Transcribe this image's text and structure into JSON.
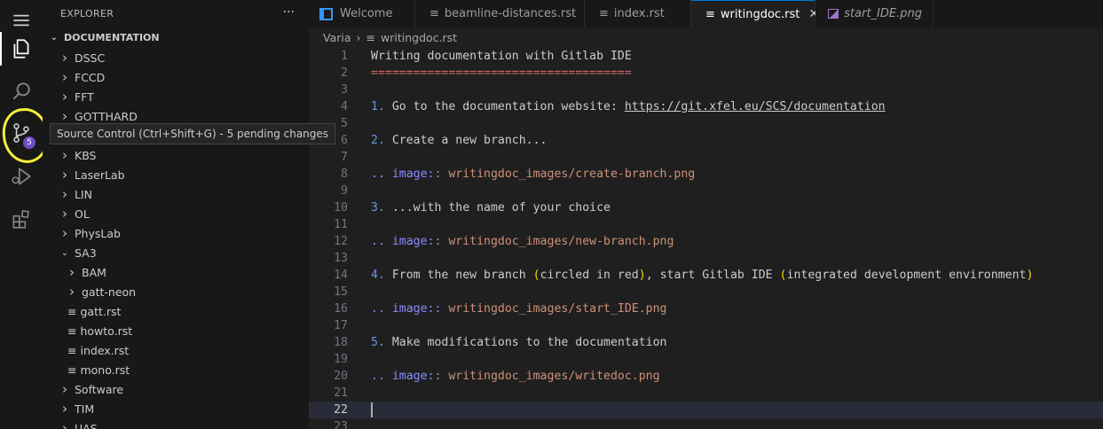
{
  "sidebar": {
    "title": "EXPLORER",
    "more": "···",
    "section": "DOCUMENTATION",
    "items": [
      {
        "label": "DSSC",
        "type": "folder",
        "depth": 1,
        "open": false
      },
      {
        "label": "FCCD",
        "type": "folder",
        "depth": 1,
        "open": false
      },
      {
        "label": "FFT",
        "type": "folder",
        "depth": 1,
        "open": false
      },
      {
        "label": "GOTTHARD",
        "type": "folder",
        "depth": 1,
        "open": false
      },
      {
        "label": "",
        "type": "folder",
        "depth": 1,
        "open": false
      },
      {
        "label": "KBS",
        "type": "folder",
        "depth": 1,
        "open": false
      },
      {
        "label": "LaserLab",
        "type": "folder",
        "depth": 1,
        "open": false
      },
      {
        "label": "LIN",
        "type": "folder",
        "depth": 1,
        "open": false
      },
      {
        "label": "OL",
        "type": "folder",
        "depth": 1,
        "open": false
      },
      {
        "label": "PhysLab",
        "type": "folder",
        "depth": 1,
        "open": false
      },
      {
        "label": "SA3",
        "type": "folder",
        "depth": 1,
        "open": true
      },
      {
        "label": "BAM",
        "type": "folder",
        "depth": 2,
        "open": false
      },
      {
        "label": "gatt-neon",
        "type": "folder",
        "depth": 2,
        "open": false
      },
      {
        "label": "gatt.rst",
        "type": "file",
        "depth": 2
      },
      {
        "label": "howto.rst",
        "type": "file",
        "depth": 2
      },
      {
        "label": "index.rst",
        "type": "file",
        "depth": 2
      },
      {
        "label": "mono.rst",
        "type": "file",
        "depth": 2
      },
      {
        "label": "Software",
        "type": "folder",
        "depth": 1,
        "open": false
      },
      {
        "label": "TIM",
        "type": "folder",
        "depth": 1,
        "open": false
      },
      {
        "label": "UAS",
        "type": "folder",
        "depth": 1,
        "open": false
      }
    ]
  },
  "activity": {
    "source_control_badge": "5",
    "tooltip": "Source Control (Ctrl+Shift+G) - 5 pending changes"
  },
  "tabs": [
    {
      "label": "Welcome",
      "icon": "vscode-icon",
      "active": false
    },
    {
      "label": "beamline-distances.rst",
      "icon": "file-lines-icon",
      "active": false
    },
    {
      "label": "index.rst",
      "icon": "file-lines-icon",
      "active": false
    },
    {
      "label": "writingdoc.rst",
      "icon": "file-lines-icon",
      "active": true,
      "close": "✕"
    },
    {
      "label": "start_IDE.png",
      "icon": "image-icon",
      "active": false,
      "italic": true
    }
  ],
  "breadcrumb": {
    "folder": "Varia",
    "sep": "›",
    "file": "writingdoc.rst"
  },
  "editor": {
    "current_line": 22,
    "lines": [
      [
        {
          "t": "Writing documentation with Gitlab IDE",
          "c": "t-heading"
        }
      ],
      [
        {
          "t": "=====================================",
          "c": "t-under"
        }
      ],
      [],
      [
        {
          "t": "1.",
          "c": "t-num"
        },
        {
          "t": " Go to the documentation website: ",
          "c": ""
        },
        {
          "t": "https://git.xfel.eu/SCS/documentation",
          "c": "t-url"
        }
      ],
      [],
      [
        {
          "t": "2.",
          "c": "t-num"
        },
        {
          "t": " Create a new branch...",
          "c": ""
        }
      ],
      [],
      [
        {
          "t": ".. image::",
          "c": "t-directive"
        },
        {
          "t": " writingdoc_images/create-branch.png",
          "c": "t-path"
        }
      ],
      [],
      [
        {
          "t": "3.",
          "c": "t-num"
        },
        {
          "t": " ...with the name of your choice",
          "c": ""
        }
      ],
      [],
      [
        {
          "t": ".. image::",
          "c": "t-directive"
        },
        {
          "t": " writingdoc_images/new-branch.png",
          "c": "t-path"
        }
      ],
      [],
      [
        {
          "t": "4.",
          "c": "t-num"
        },
        {
          "t": " From the new branch ",
          "c": ""
        },
        {
          "t": "(",
          "c": "t-paren"
        },
        {
          "t": "circled in red",
          "c": ""
        },
        {
          "t": ")",
          "c": "t-paren"
        },
        {
          "t": ", start Gitlab IDE ",
          "c": ""
        },
        {
          "t": "(",
          "c": "t-paren"
        },
        {
          "t": "integrated development environment",
          "c": ""
        },
        {
          "t": ")",
          "c": "t-paren"
        }
      ],
      [],
      [
        {
          "t": ".. image::",
          "c": "t-directive"
        },
        {
          "t": " writingdoc_images/start_IDE.png",
          "c": "t-path"
        }
      ],
      [],
      [
        {
          "t": "5.",
          "c": "t-num"
        },
        {
          "t": " Make modifications to the documentation",
          "c": ""
        }
      ],
      [],
      [
        {
          "t": ".. image::",
          "c": "t-directive"
        },
        {
          "t": " writingdoc_images/writedoc.png",
          "c": "t-path"
        }
      ],
      [],
      [],
      []
    ]
  }
}
